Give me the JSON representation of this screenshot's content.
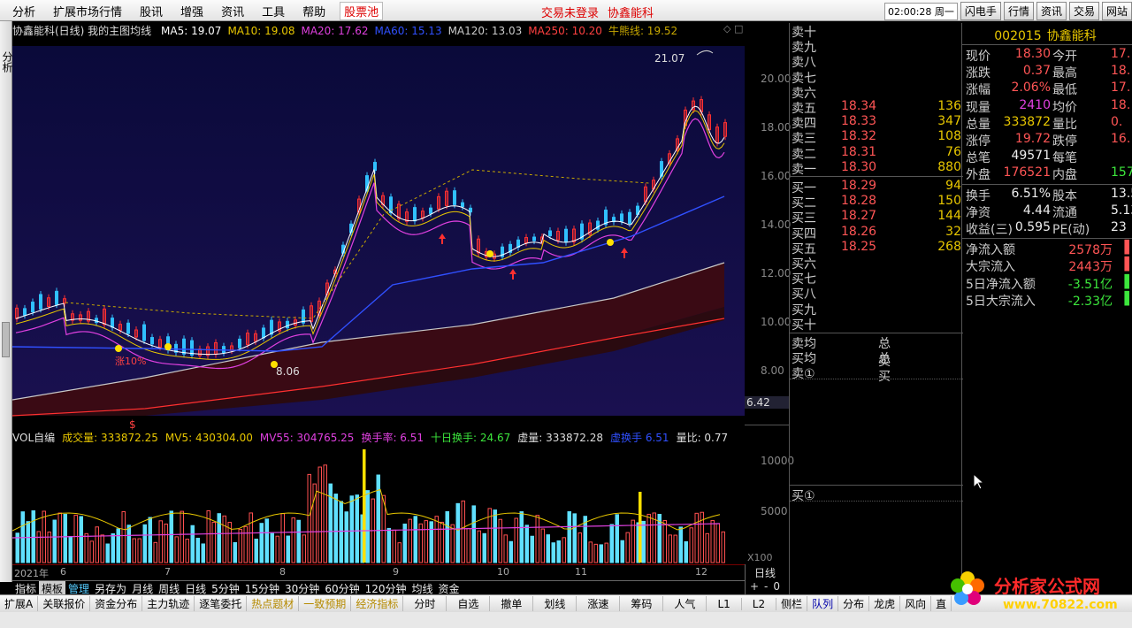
{
  "menu": [
    "分析",
    "扩展市场行情",
    "股讯",
    "增强",
    "资讯",
    "工具",
    "帮助"
  ],
  "stock_pool": "股票池",
  "center_status": [
    "交易未登录",
    "协鑫能科"
  ],
  "right": {
    "clock": "02:00:28 周一",
    "buttons": [
      "闪电手",
      "行情",
      "资讯",
      "交易",
      "网站"
    ]
  },
  "left_strip_label": "分析",
  "chart": {
    "title": "协鑫能科(日线) 我的主图均线",
    "ma": [
      {
        "label": "MA5: 19.07",
        "color": "#ffffff"
      },
      {
        "label": "MA10: 19.08",
        "color": "#e8c700"
      },
      {
        "label": "MA20: 17.62",
        "color": "#e040e0"
      },
      {
        "label": "MA60: 15.13",
        "color": "#3050ff"
      },
      {
        "label": "MA120: 13.03",
        "color": "#cccccc"
      },
      {
        "label": "MA250: 10.20",
        "color": "#ff4040"
      },
      {
        "label": "牛熊线: 19.52",
        "color": "#c8a800"
      }
    ],
    "annotations": {
      "high": "21.07",
      "low": "8.06",
      "pct": "涨10%",
      "current": "6.42",
      "marker": "$"
    }
  },
  "volume": {
    "labels": [
      {
        "text": "VOL自编",
        "color": "#dddddd"
      },
      {
        "text": "成交量: 333872.25",
        "color": "#e8c700"
      },
      {
        "text": "MV5: 430304.00",
        "color": "#e8c700"
      },
      {
        "text": "MV55: 304765.25",
        "color": "#e040e0"
      },
      {
        "text": "换手率: 6.51",
        "color": "#e040e0"
      },
      {
        "text": "十日换手: 24.67",
        "color": "#3ce63c"
      },
      {
        "text": "虚量: 333872.28",
        "color": "#dddddd"
      },
      {
        "text": "虚换手 6.51",
        "color": "#3050ff"
      },
      {
        "text": "量比: 0.77",
        "color": "#dddddd"
      }
    ]
  },
  "x_axis": [
    "2021年",
    "6",
    "7",
    "8",
    "9",
    "10",
    "11",
    "12"
  ],
  "zoom": {
    "label": "X100",
    "period": "日线",
    "controls": "+-0"
  },
  "tabs1": [
    "指标",
    "模板",
    "管理",
    "另存为",
    "月线",
    "周线",
    "日线",
    "5分钟",
    "15分钟",
    "30分钟",
    "60分钟",
    "120分钟",
    "均线",
    "资金"
  ],
  "tabs2": [
    "扩展A",
    "关联报价",
    "资金分布",
    "主力轨迹",
    "逐笔委托",
    "热点题材",
    "一致预期",
    "经济指标",
    "分时",
    "自选",
    "撤单",
    "划线",
    "涨速",
    "筹码",
    "人气",
    "L1",
    "L2",
    "侧栏",
    "队列",
    "分布",
    "龙虎",
    "风向",
    "直"
  ],
  "orderbook": {
    "sell_empty": [
      "卖十",
      "卖九",
      "卖八",
      "卖七",
      "卖六"
    ],
    "sell": [
      {
        "l": "卖五",
        "p": "18.34",
        "v": "136"
      },
      {
        "l": "卖四",
        "p": "18.33",
        "v": "347"
      },
      {
        "l": "卖三",
        "p": "18.32",
        "v": "108"
      },
      {
        "l": "卖二",
        "p": "18.31",
        "v": "76"
      },
      {
        "l": "卖一",
        "p": "18.30",
        "v": "880"
      }
    ],
    "buy": [
      {
        "l": "买一",
        "p": "18.29",
        "v": "94"
      },
      {
        "l": "买二",
        "p": "18.28",
        "v": "150"
      },
      {
        "l": "买三",
        "p": "18.27",
        "v": "144"
      },
      {
        "l": "买四",
        "p": "18.26",
        "v": "32"
      },
      {
        "l": "买五",
        "p": "18.25",
        "v": "268"
      }
    ],
    "buy_empty": [
      "买六",
      "买七",
      "买八",
      "买九",
      "买十"
    ],
    "avg_sell": "卖均",
    "total_sell": "总卖",
    "avg_buy": "买均",
    "total_buy": "总买",
    "queue_sell": "卖①",
    "queue_buy": "买①"
  },
  "info": {
    "code": "002015",
    "name": "协鑫能科",
    "rows": [
      {
        "l": "现价",
        "v": "18.30",
        "c": "red",
        "l2": "今开",
        "v2": "17."
      },
      {
        "l": "涨跌",
        "v": "0.37",
        "c": "red",
        "l2": "最高",
        "v2": "18."
      },
      {
        "l": "涨幅",
        "v": "2.06%",
        "c": "red",
        "l2": "最低",
        "v2": "17."
      },
      {
        "l": "现量",
        "v": "2410",
        "c": "mag",
        "l2": "均价",
        "v2": "18."
      },
      {
        "l": "总量",
        "v": "333872",
        "c": "yel",
        "l2": "量比",
        "v2": "0."
      },
      {
        "l": "涨停",
        "v": "19.72",
        "c": "red",
        "l2": "跌停",
        "v2": "16."
      },
      {
        "l": "总笔",
        "v": "49571",
        "c": "wht",
        "l2": "每笔",
        "v2": ""
      },
      {
        "l": "外盘",
        "v": "176521",
        "c": "red",
        "l2": "内盘",
        "v2": "1573"
      }
    ],
    "rows2": [
      {
        "l": "换手",
        "v": "6.51%",
        "c": "wht",
        "l2": "股本",
        "v2": "13.5"
      },
      {
        "l": "净资",
        "v": "4.44",
        "c": "wht",
        "l2": "流通",
        "v2": "5.13"
      },
      {
        "l": "收益(三)",
        "v": "0.595",
        "c": "wht",
        "l2": "PE(动)",
        "v2": "23"
      }
    ],
    "flows": [
      {
        "l": "净流入额",
        "v": "2578万",
        "c": "red"
      },
      {
        "l": "大宗流入",
        "v": "2443万",
        "c": "red"
      },
      {
        "l": "5日净流入额",
        "v": "-3.51亿",
        "c": "grn"
      },
      {
        "l": "5日大宗流入",
        "v": "-2.33亿",
        "c": "grn"
      }
    ]
  },
  "logo": {
    "cn": "分析家公式网",
    "url": "www.70822.com"
  },
  "price_axis": [
    "20.00",
    "18.00",
    "16.00",
    "14.00",
    "12.00",
    "10.00",
    "8.00"
  ],
  "vol_axis": [
    "10000",
    "5000"
  ]
}
